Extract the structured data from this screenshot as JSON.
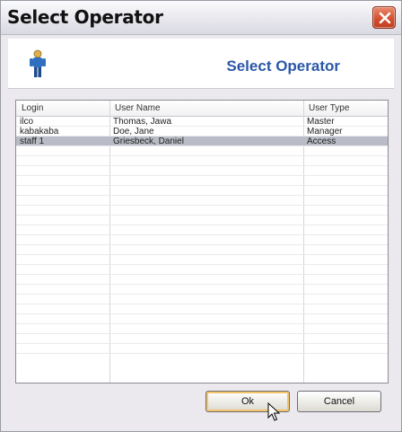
{
  "window": {
    "title": "Select Operator"
  },
  "header": {
    "title": "Select Operator",
    "icon": "person-icon"
  },
  "table": {
    "columns": [
      "Login",
      "User Name",
      "User Type"
    ],
    "rows": [
      {
        "login": "ilco",
        "name": "Thomas, Jawa",
        "type": "Master"
      },
      {
        "login": "kabakaba",
        "name": "Doe, Jane",
        "type": "Manager"
      },
      {
        "login": "staff 1",
        "name": "Griesbeck, Daniel",
        "type": "Access"
      }
    ],
    "selected_row": 3
  },
  "buttons": {
    "ok_label": "Ok",
    "cancel_label": "Cancel"
  },
  "colors": {
    "header_title": "#2a58a8",
    "selection": "#b9bcc6",
    "close_button": "#d4502e"
  }
}
